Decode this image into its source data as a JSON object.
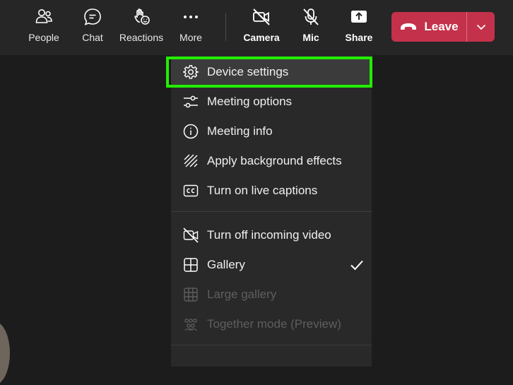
{
  "toolbar": {
    "people": "People",
    "chat": "Chat",
    "reactions": "Reactions",
    "more": "More",
    "camera": "Camera",
    "mic": "Mic",
    "share": "Share",
    "leave": "Leave"
  },
  "menu": {
    "items": [
      {
        "label": "Device settings",
        "icon": "gear-icon",
        "state": "highlighted"
      },
      {
        "label": "Meeting options",
        "icon": "sliders-icon"
      },
      {
        "label": "Meeting info",
        "icon": "info-icon"
      },
      {
        "label": "Apply background effects",
        "icon": "background-effects-icon"
      },
      {
        "label": "Turn on live captions",
        "icon": "cc-icon"
      },
      {
        "label": "Turn off incoming video",
        "icon": "video-off-icon"
      },
      {
        "label": "Gallery",
        "icon": "gallery-icon",
        "checked": true
      },
      {
        "label": "Large gallery",
        "icon": "large-gallery-icon",
        "state": "disabled"
      },
      {
        "label": "Together mode (Preview)",
        "icon": "together-mode-icon",
        "state": "disabled"
      }
    ]
  },
  "colors": {
    "toolbar_bg": "#262626",
    "menu_bg": "#292929",
    "leave_red": "#c4314b",
    "highlight_green": "#22ee00"
  }
}
